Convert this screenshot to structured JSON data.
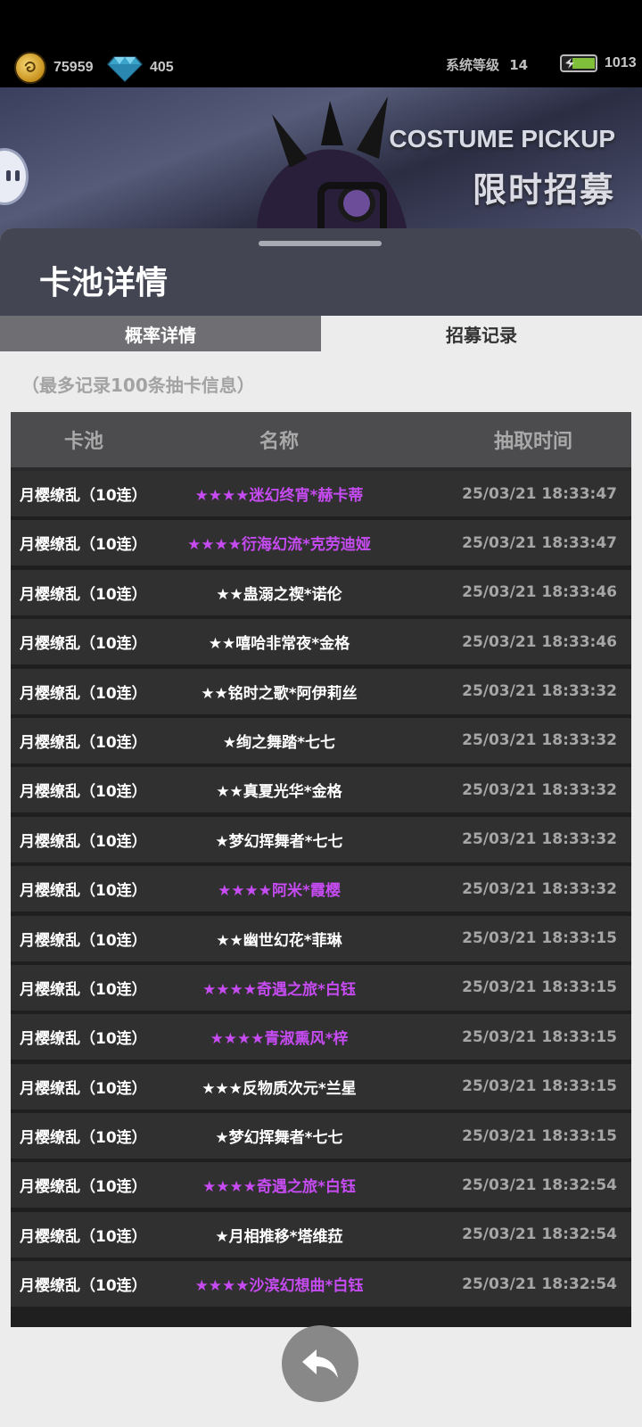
{
  "status": {
    "coins": "75959",
    "gems": "405",
    "system_level_label": "系统等级",
    "system_level": "14",
    "energy": "1013"
  },
  "banner": {
    "title_en": "COSTUME PICKUP",
    "title_cn": "限时招募"
  },
  "sheet": {
    "title": "卡池详情",
    "tabs": [
      {
        "label": "概率详情",
        "active": false
      },
      {
        "label": "招募记录",
        "active": true
      }
    ],
    "note": "（最多记录100条抽卡信息）",
    "columns": {
      "pool": "卡池",
      "name": "名称",
      "time": "抽取时间"
    },
    "rows": [
      {
        "pool": "月樱缭乱（10连）",
        "name": "★★★★迷幻终宵*赫卡蒂",
        "time": "25/03/21 18:33:47",
        "rarity": "purple"
      },
      {
        "pool": "月樱缭乱（10连）",
        "name": "★★★★衍海幻流*克劳迪娅",
        "time": "25/03/21 18:33:47",
        "rarity": "purple"
      },
      {
        "pool": "月樱缭乱（10连）",
        "name": "★★蛊溺之禊*诺伦",
        "time": "25/03/21 18:33:46",
        "rarity": "white"
      },
      {
        "pool": "月樱缭乱（10连）",
        "name": "★★嘻哈非常夜*金格",
        "time": "25/03/21 18:33:46",
        "rarity": "white"
      },
      {
        "pool": "月樱缭乱（10连）",
        "name": "★★铭时之歌*阿伊莉丝",
        "time": "25/03/21 18:33:32",
        "rarity": "white"
      },
      {
        "pool": "月樱缭乱（10连）",
        "name": "★绚之舞踏*七七",
        "time": "25/03/21 18:33:32",
        "rarity": "white"
      },
      {
        "pool": "月樱缭乱（10连）",
        "name": "★★真夏光华*金格",
        "time": "25/03/21 18:33:32",
        "rarity": "white"
      },
      {
        "pool": "月樱缭乱（10连）",
        "name": "★梦幻挥舞者*七七",
        "time": "25/03/21 18:33:32",
        "rarity": "white"
      },
      {
        "pool": "月樱缭乱（10连）",
        "name": "★★★★阿米*霞樱",
        "time": "25/03/21 18:33:32",
        "rarity": "purple"
      },
      {
        "pool": "月樱缭乱（10连）",
        "name": "★★幽世幻花*菲琳",
        "time": "25/03/21 18:33:15",
        "rarity": "white"
      },
      {
        "pool": "月樱缭乱（10连）",
        "name": "★★★★奇遇之旅*白钰",
        "time": "25/03/21 18:33:15",
        "rarity": "purple"
      },
      {
        "pool": "月樱缭乱（10连）",
        "name": "★★★★青淑熏风*梓",
        "time": "25/03/21 18:33:15",
        "rarity": "purple"
      },
      {
        "pool": "月樱缭乱（10连）",
        "name": "★★★反物质次元*兰星",
        "time": "25/03/21 18:33:15",
        "rarity": "white"
      },
      {
        "pool": "月樱缭乱（10连）",
        "name": "★梦幻挥舞者*七七",
        "time": "25/03/21 18:33:15",
        "rarity": "white"
      },
      {
        "pool": "月樱缭乱（10连）",
        "name": "★★★★奇遇之旅*白钰",
        "time": "25/03/21 18:32:54",
        "rarity": "purple"
      },
      {
        "pool": "月樱缭乱（10连）",
        "name": "★月相推移*塔维菈",
        "time": "25/03/21 18:32:54",
        "rarity": "white"
      },
      {
        "pool": "月樱缭乱（10连）",
        "name": "★★★★沙滨幻想曲*白钰",
        "time": "25/03/21 18:32:54",
        "rarity": "purple"
      }
    ]
  },
  "icons": {
    "coin": "coin-icon",
    "gem": "diamond-icon",
    "energy": "battery-icon",
    "back": "back-arrow-icon"
  },
  "colors": {
    "purple_rarity": "#c64bf2",
    "row_bg": "#303030",
    "header_bg": "#434552"
  }
}
